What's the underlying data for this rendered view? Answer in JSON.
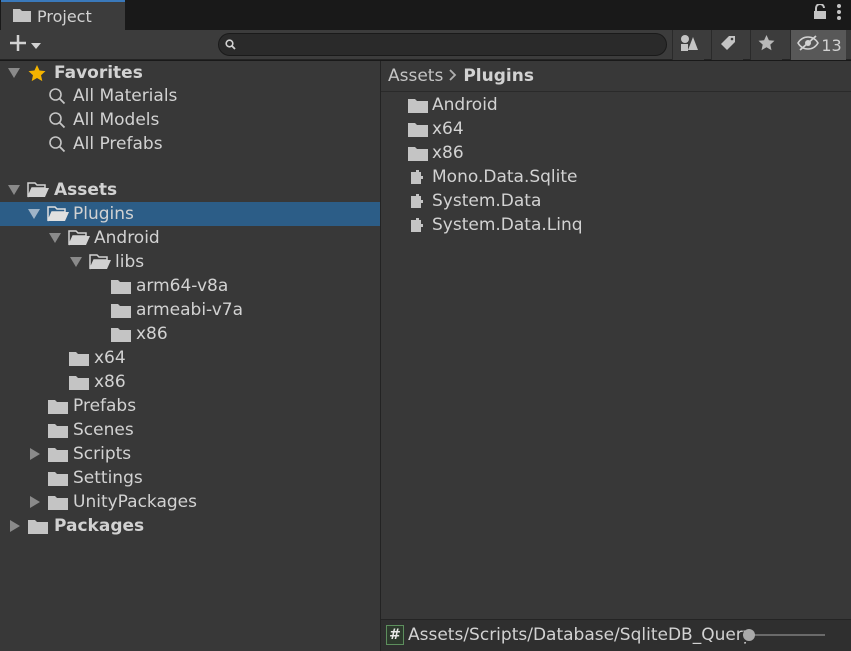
{
  "tab": {
    "title": "Project"
  },
  "toolbar": {
    "search_placeholder": "",
    "hidden_count": "13"
  },
  "tree": {
    "favorites": {
      "label": "Favorites",
      "items": [
        "All Materials",
        "All Models",
        "All Prefabs"
      ]
    },
    "assets": {
      "label": "Assets",
      "plugins": "Plugins",
      "android": "Android",
      "libs": "libs",
      "libs_children": [
        "arm64-v8a",
        "armeabi-v7a",
        "x86"
      ],
      "x64": "x64",
      "x86": "x86",
      "prefabs": "Prefabs",
      "scenes": "Scenes",
      "scripts": "Scripts",
      "settings": "Settings",
      "unity_packages": "UnityPackages"
    },
    "packages": {
      "label": "Packages"
    }
  },
  "breadcrumb": {
    "root": "Assets",
    "current": "Plugins"
  },
  "content": {
    "folders": [
      "Android",
      "x64",
      "x86"
    ],
    "plugins": [
      "Mono.Data.Sqlite",
      "System.Data",
      "System.Data.Linq"
    ]
  },
  "footer": {
    "path": "Assets/Scripts/Database/SqliteDB_Query.cs",
    "zoom": 0
  },
  "colors": {
    "selection": "#2c5d87",
    "panel": "#383838",
    "toolbar": "#3c3c3c",
    "star": "#f4b400"
  }
}
